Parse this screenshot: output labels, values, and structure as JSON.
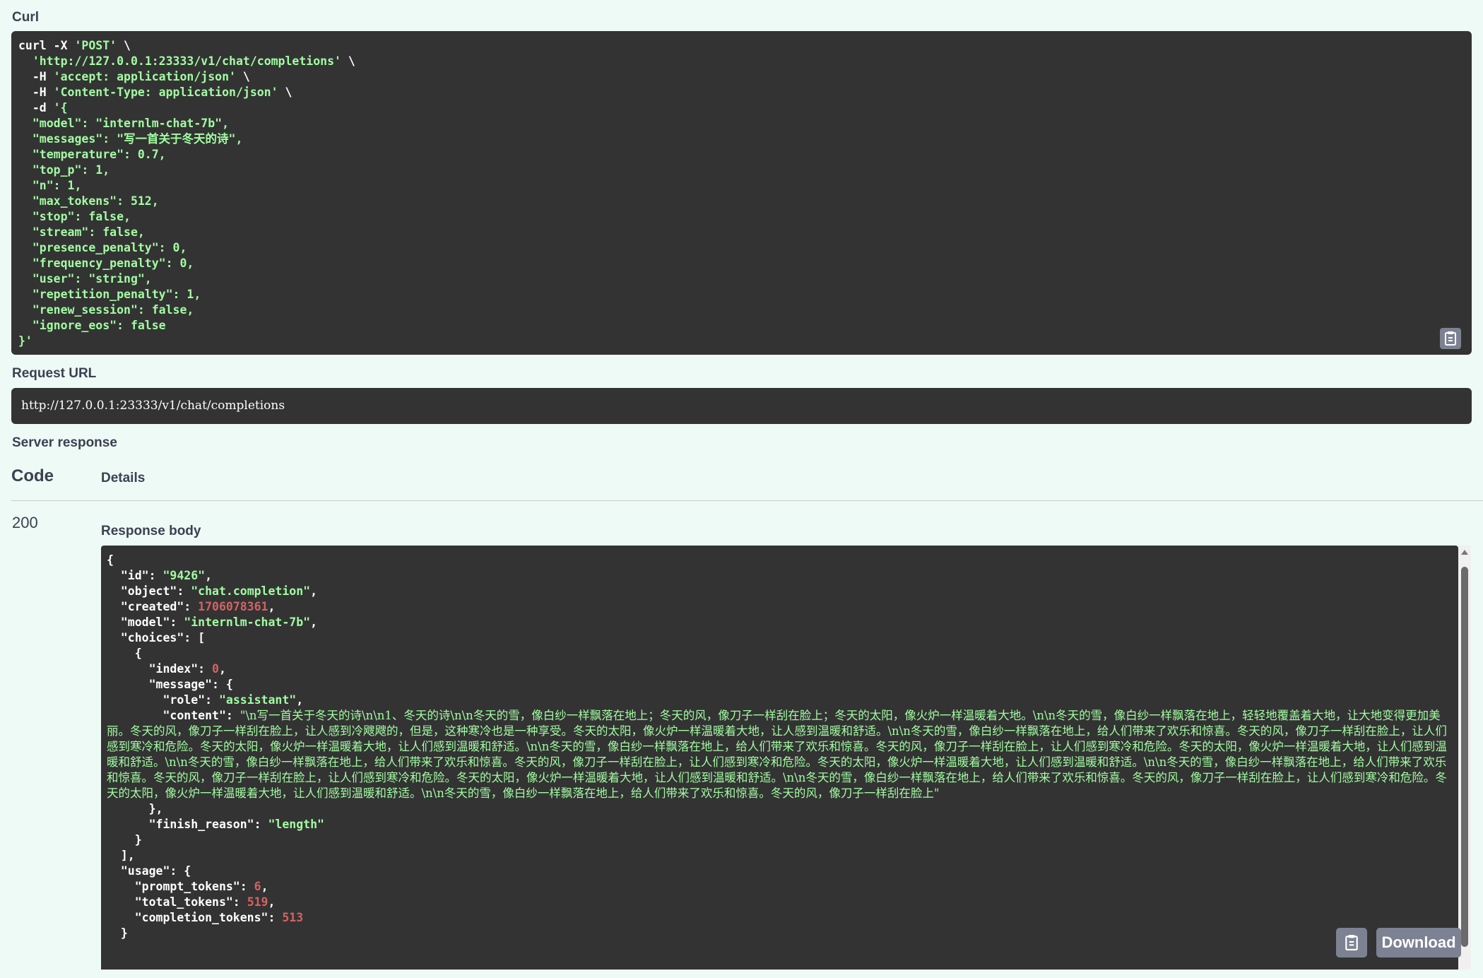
{
  "labels": {
    "curl": "Curl",
    "request_url": "Request URL",
    "server_response": "Server response",
    "code": "Code",
    "details": "Details",
    "response_body": "Response body",
    "download": "Download"
  },
  "curl_lines": [
    [
      {
        "t": "curl -X "
      },
      {
        "t": "'POST'",
        "c": "str"
      },
      {
        "t": " \\"
      }
    ],
    [
      {
        "t": "  "
      },
      {
        "t": "'http://127.0.0.1:23333/v1/chat/completions'",
        "c": "str"
      },
      {
        "t": " \\"
      }
    ],
    [
      {
        "t": "  -H "
      },
      {
        "t": "'accept: application/json'",
        "c": "str"
      },
      {
        "t": " \\"
      }
    ],
    [
      {
        "t": "  -H "
      },
      {
        "t": "'Content-Type: application/json'",
        "c": "str"
      },
      {
        "t": " \\"
      }
    ],
    [
      {
        "t": "  -d "
      },
      {
        "t": "'{",
        "c": "str"
      }
    ],
    [
      {
        "t": "  \"model\": \"internlm-chat-7b\",",
        "c": "str"
      }
    ],
    [
      {
        "t": "  \"messages\": \"写一首关于冬天的诗\",",
        "c": "str"
      }
    ],
    [
      {
        "t": "  \"temperature\": 0.7,",
        "c": "str"
      }
    ],
    [
      {
        "t": "  \"top_p\": 1,",
        "c": "str"
      }
    ],
    [
      {
        "t": "  \"n\": 1,",
        "c": "str"
      }
    ],
    [
      {
        "t": "  \"max_tokens\": 512,",
        "c": "str"
      }
    ],
    [
      {
        "t": "  \"stop\": false,",
        "c": "str"
      }
    ],
    [
      {
        "t": "  \"stream\": false,",
        "c": "str"
      }
    ],
    [
      {
        "t": "  \"presence_penalty\": 0,",
        "c": "str"
      }
    ],
    [
      {
        "t": "  \"frequency_penalty\": 0,",
        "c": "str"
      }
    ],
    [
      {
        "t": "  \"user\": \"string\",",
        "c": "str"
      }
    ],
    [
      {
        "t": "  \"repetition_penalty\": 1,",
        "c": "str"
      }
    ],
    [
      {
        "t": "  \"renew_session\": false,",
        "c": "str"
      }
    ],
    [
      {
        "t": "  \"ignore_eos\": false",
        "c": "str"
      }
    ],
    [
      {
        "t": "}'",
        "c": "str"
      }
    ]
  ],
  "request_url": "http://127.0.0.1:23333/v1/chat/completions",
  "status_code": "200",
  "response_lines": [
    [
      {
        "t": "{"
      }
    ],
    [
      {
        "t": "  \"id\": "
      },
      {
        "t": "\"9426\"",
        "c": "str"
      },
      {
        "t": ","
      }
    ],
    [
      {
        "t": "  \"object\": "
      },
      {
        "t": "\"chat.completion\"",
        "c": "str"
      },
      {
        "t": ","
      }
    ],
    [
      {
        "t": "  \"created\": "
      },
      {
        "t": "1706078361",
        "c": "num"
      },
      {
        "t": ","
      }
    ],
    [
      {
        "t": "  \"model\": "
      },
      {
        "t": "\"internlm-chat-7b\"",
        "c": "str"
      },
      {
        "t": ","
      }
    ],
    [
      {
        "t": "  \"choices\": ["
      }
    ],
    [
      {
        "t": "    {"
      }
    ],
    [
      {
        "t": "      \"index\": "
      },
      {
        "t": "0",
        "c": "num"
      },
      {
        "t": ","
      }
    ],
    [
      {
        "t": "      \"message\": {"
      }
    ],
    [
      {
        "t": "        \"role\": "
      },
      {
        "t": "\"assistant\"",
        "c": "str"
      },
      {
        "t": ","
      }
    ]
  ],
  "response_content_prefix": "        \"content\": ",
  "response_content": "\"\\n写一首关于冬天的诗\\n\\n1、冬天的诗\\n\\n冬天的雪，像白纱一样飘落在地上；冬天的风，像刀子一样刮在脸上；冬天的太阳，像火炉一样温暖着大地。\\n\\n冬天的雪，像白纱一样飘落在地上，轻轻地覆盖着大地，让大地变得更加美丽。冬天的风，像刀子一样刮在脸上，让人感到冷飕飕的，但是，这种寒冷也是一种享受。冬天的太阳，像火炉一样温暖着大地，让人感到温暖和舒适。\\n\\n冬天的雪，像白纱一样飘落在地上，给人们带来了欢乐和惊喜。冬天的风，像刀子一样刮在脸上，让人们感到寒冷和危险。冬天的太阳，像火炉一样温暖着大地，让人们感到温暖和舒适。\\n\\n冬天的雪，像白纱一样飘落在地上，给人们带来了欢乐和惊喜。冬天的风，像刀子一样刮在脸上，让人们感到寒冷和危险。冬天的太阳，像火炉一样温暖着大地，让人们感到温暖和舒适。\\n\\n冬天的雪，像白纱一样飘落在地上，给人们带来了欢乐和惊喜。冬天的风，像刀子一样刮在脸上，让人们感到寒冷和危险。冬天的太阳，像火炉一样温暖着大地，让人们感到温暖和舒适。\\n\\n冬天的雪，像白纱一样飘落在地上，给人们带来了欢乐和惊喜。冬天的风，像刀子一样刮在脸上，让人们感到寒冷和危险。冬天的太阳，像火炉一样温暖着大地，让人们感到温暖和舒适。\\n\\n冬天的雪，像白纱一样飘落在地上，给人们带来了欢乐和惊喜。冬天的风，像刀子一样刮在脸上，让人们感到寒冷和危险。冬天的太阳，像火炉一样温暖着大地，让人们感到温暖和舒适。\\n\\n冬天的雪，像白纱一样飘落在地上，给人们带来了欢乐和惊喜。冬天的风，像刀子一样刮在脸上\"",
  "response_tail_lines": [
    [
      {
        "t": "      },"
      }
    ],
    [
      {
        "t": "      \"finish_reason\": "
      },
      {
        "t": "\"length\"",
        "c": "str"
      }
    ],
    [
      {
        "t": "    }"
      }
    ],
    [
      {
        "t": "  ],"
      }
    ],
    [
      {
        "t": "  \"usage\": {"
      }
    ],
    [
      {
        "t": "    \"prompt_tokens\": "
      },
      {
        "t": "6",
        "c": "num"
      },
      {
        "t": ","
      }
    ],
    [
      {
        "t": "    \"total_tokens\": "
      },
      {
        "t": "519",
        "c": "num"
      },
      {
        "t": ","
      }
    ],
    [
      {
        "t": "    \"completion_tokens\": "
      },
      {
        "t": "513",
        "c": "num"
      }
    ],
    [
      {
        "t": "  }"
      }
    ]
  ],
  "colors": {
    "background": "#eefaf5",
    "code_bg": "#333333",
    "string": "#a2fca2",
    "number": "#d36363",
    "button": "#7d8293"
  },
  "icons": {
    "copy": "clipboard-icon"
  }
}
